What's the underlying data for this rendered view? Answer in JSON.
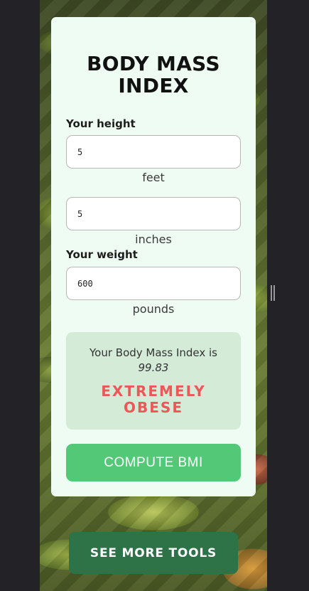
{
  "card": {
    "title": "BODY MASS INDEX",
    "height_label": "Your height",
    "feet_value": "5",
    "feet_unit": "feet",
    "inches_value": "5",
    "inches_unit": "inches",
    "weight_label": "Your weight",
    "pounds_value": "600",
    "pounds_unit": "pounds"
  },
  "result": {
    "text": "Your Body Mass Index is",
    "value": "99.83",
    "category_line1": "EXTREMELY",
    "category_line2": "OBESE",
    "category_color": "#ec5757"
  },
  "buttons": {
    "compute_label": "COMPUTE BMI",
    "more_label": "SEE MORE TOOLS"
  },
  "colors": {
    "accent": "#53c978",
    "dark_accent": "#2e7248",
    "card_bg": "#effcf3",
    "result_bg": "#d4ecd7"
  }
}
